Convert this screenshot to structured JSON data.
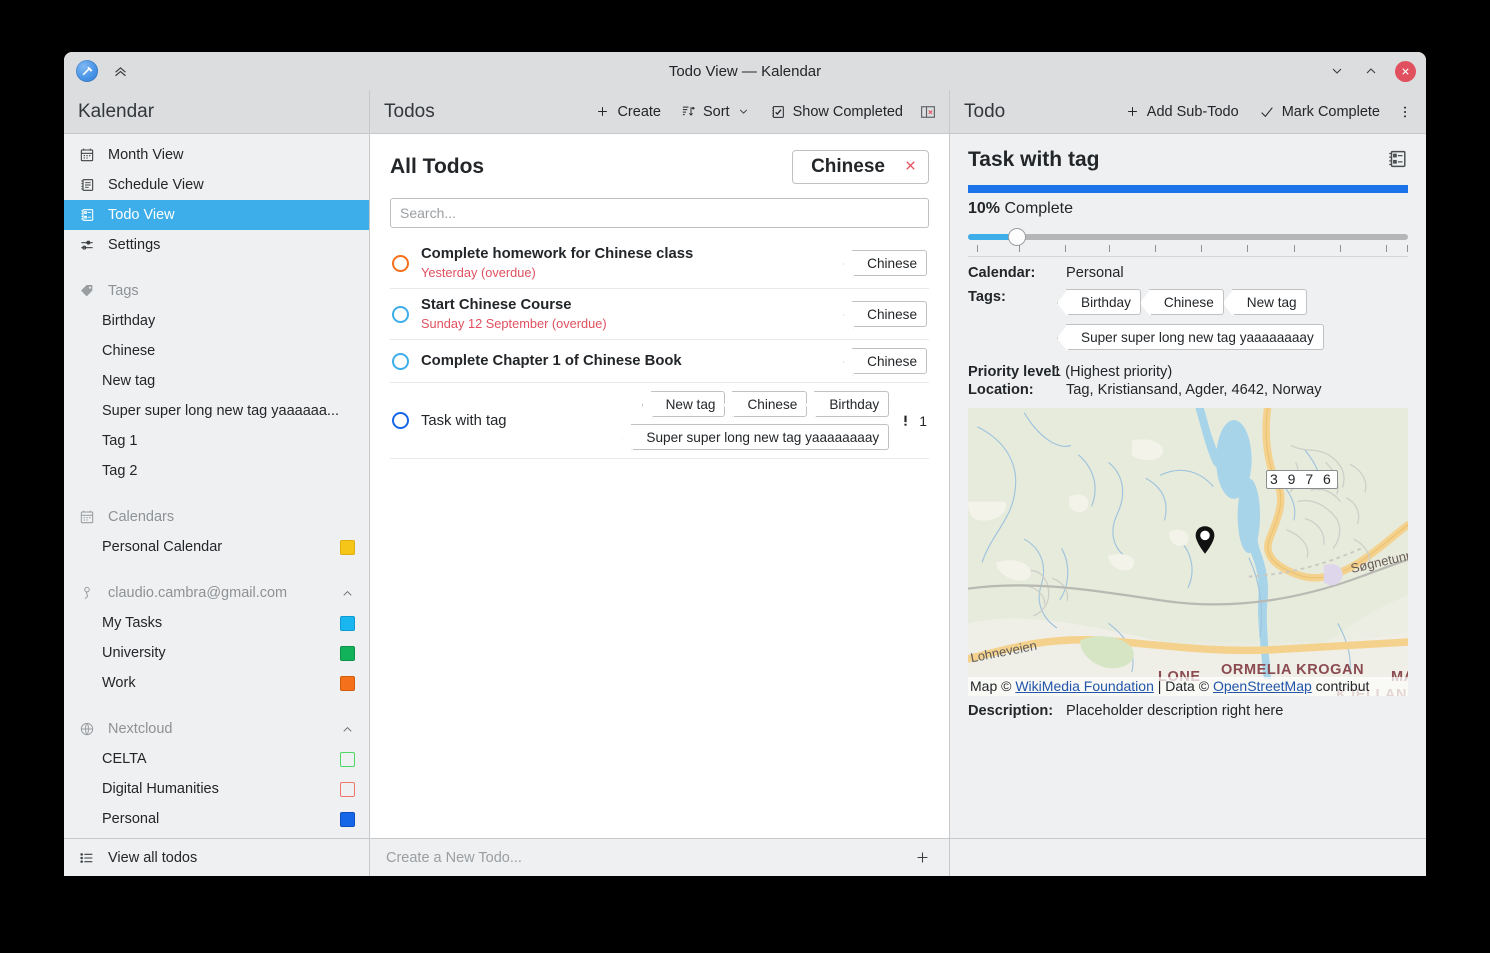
{
  "window": {
    "title": "Todo View — Kalendar",
    "app_icon": "hammer-app-icon",
    "collapse_icon": "double-chevron-up-icon",
    "minimize_label": "Minimize",
    "maximize_label": "Maximize",
    "close_label": "Close"
  },
  "sidebar": {
    "header": "Kalendar",
    "views": [
      {
        "label": "Month View",
        "icon": "calendar-icon",
        "selected": false
      },
      {
        "label": "Schedule View",
        "icon": "schedule-icon",
        "selected": false
      },
      {
        "label": "Todo View",
        "icon": "todo-list-icon",
        "selected": true
      },
      {
        "label": "Settings",
        "icon": "sliders-icon",
        "selected": false
      }
    ],
    "tags_section": {
      "title": "Tags",
      "icon": "tag-icon",
      "items": [
        "Birthday",
        "Chinese",
        "New tag",
        "Super super long new tag yaaaaaa...",
        "Tag 1",
        "Tag 2"
      ]
    },
    "calendars_section": {
      "title": "Calendars",
      "icon": "calendar-icon",
      "items": [
        {
          "label": "Personal Calendar",
          "color": "#f5c518"
        }
      ]
    },
    "account_section": {
      "title": "claudio.cambra@gmail.com",
      "icon": "key-icon",
      "chevron": "chevron-up-icon",
      "items": [
        {
          "label": "My Tasks",
          "color": "#1ab6ef"
        },
        {
          "label": "University",
          "color": "#11b25a"
        },
        {
          "label": "Work",
          "color": "#f5701a"
        }
      ]
    },
    "nextcloud_section": {
      "title": "Nextcloud",
      "icon": "globe-icon",
      "chevron": "chevron-up-icon",
      "items": [
        {
          "label": "CELTA",
          "color": "#4bd964",
          "filled": false
        },
        {
          "label": "Digital Humanities",
          "color": "#f2756a",
          "filled": false
        },
        {
          "label": "Personal",
          "color": "#1667e8",
          "filled": true
        }
      ]
    },
    "footer": {
      "label": "View all todos",
      "icon": "list-icon"
    }
  },
  "middle": {
    "header": "Todos",
    "toolbar": {
      "create": "Create",
      "sort": "Sort",
      "show_completed": "Show Completed",
      "panel_close_icon": "close-panel-icon"
    },
    "list_title": "All Todos",
    "filter_chip": {
      "label": "Chinese",
      "clear_icon": "close-icon"
    },
    "search_placeholder": "Search...",
    "todos": [
      {
        "name": "Complete homework for Chinese class",
        "due": "Yesterday (overdue)",
        "checkbox_color": "#f5701a",
        "tags": [
          "Chinese"
        ],
        "priority": null
      },
      {
        "name": "Start Chinese Course",
        "due": "Sunday 12 September (overdue)",
        "checkbox_color": "#3daee9",
        "tags": [
          "Chinese"
        ],
        "priority": null
      },
      {
        "name": "Complete Chapter 1 of Chinese Book",
        "due": "",
        "checkbox_color": "#3daee9",
        "tags": [
          "Chinese"
        ],
        "priority": null
      },
      {
        "name": "Task with tag",
        "due": "",
        "checkbox_color": "#1667e8",
        "tags": [
          "New tag",
          "Chinese",
          "Birthday",
          "Super super long new tag yaaaaaaaay"
        ],
        "priority": "1"
      }
    ],
    "new_todo_placeholder": "Create a New Todo...",
    "add_icon": "plus-icon"
  },
  "right": {
    "header": "Todo",
    "toolbar": {
      "add_subtodo": "Add Sub-Todo",
      "mark_complete": "Mark Complete",
      "overflow_icon": "more-vertical-icon"
    },
    "task_title": "Task with tag",
    "task_icon": "todo-detail-icon",
    "progress_percent": 10,
    "progress_label_value": "10%",
    "progress_label_text": "Complete",
    "slider_value": 10,
    "details": [
      {
        "label": "Calendar:",
        "value": "Personal"
      }
    ],
    "tags_label": "Tags:",
    "tags": [
      "Birthday",
      "Chinese",
      "New tag",
      "Super super long new tag yaaaaaaaay"
    ],
    "priority_label": "Priority level:",
    "priority_value": "1 (Highest priority)",
    "location_label": "Location:",
    "location_value": "Tag, Kristiansand, Agder, 4642, Norway",
    "map": {
      "shield": "3 9 7 6",
      "labels": [
        "Søgnetunn",
        "Lohneveien",
        "LONE",
        "ORMELIA KROGAN",
        "MAST",
        "KJELLAND"
      ],
      "attribution_prefix": "Map © ",
      "attribution_link1": "WikiMedia Foundation",
      "attribution_sep": " | Data © ",
      "attribution_link2": "OpenStreetMap",
      "attribution_suffix": " contribut",
      "pin_icon": "map-pin-icon"
    },
    "description_label": "Description:",
    "description_value": "Placeholder description right here"
  },
  "colors": {
    "accent": "#3daee9",
    "progress": "#1a73e8",
    "overdue": "#e0505f",
    "window_bg": "#eff0f1",
    "titlebar_bg": "#dcdddf"
  }
}
